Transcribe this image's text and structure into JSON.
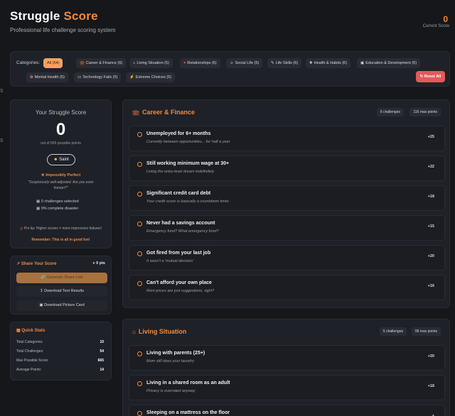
{
  "header": {
    "title_main": "Struggle",
    "title_accent": "Score",
    "subtitle": "Professional life challenge scoring system",
    "current_score": "0",
    "current_score_label": "Current Score"
  },
  "edge_marks": [
    "s",
    "s"
  ],
  "categories": {
    "label": "Categories:",
    "chips": [
      {
        "label": "All (54)",
        "icon": "",
        "active": true
      },
      {
        "label": "Career & Finance (6)",
        "icon": "briefcase-icon"
      },
      {
        "label": "Living Situation (5)",
        "icon": "house-icon"
      },
      {
        "label": "Relationships (6)",
        "icon": "heart-icon"
      },
      {
        "label": "Social Life (5)",
        "icon": "people-icon"
      },
      {
        "label": "Life Skills (6)",
        "icon": "wrench-icon"
      },
      {
        "label": "Health & Habits (6)",
        "icon": "health-icon"
      },
      {
        "label": "Education & Development (5)",
        "icon": "book-icon"
      },
      {
        "label": "Mental Health (5)",
        "icon": "brain-icon"
      },
      {
        "label": "Technology Fails (5)",
        "icon": "laptop-icon"
      },
      {
        "label": "Extreme Choices (5)",
        "icon": "lightning-icon"
      }
    ],
    "reset_label": "Reset All"
  },
  "your_score": {
    "title": "Your Struggle Score",
    "value": "0",
    "sub": "out of 665 possible points",
    "badge": "Saint",
    "rank": "Impossibly Perfect",
    "quote": "\"Suspiciously well-adjusted. Are you even human?\"",
    "selected": "0 challenges selected",
    "disaster": "0% complete disaster",
    "tip": "Pro tip: Higher scores = more impressive failures!",
    "remember": "Remember: This is all in good fun!"
  },
  "share": {
    "title": "Share Your Score",
    "pts": "0 pts",
    "generate": "Generate Share Link",
    "download_text": "Download Text Results",
    "download_picture": "Download Picture Card"
  },
  "quick_stats": {
    "title": "Quick Stats",
    "rows": [
      {
        "label": "Total Categories:",
        "value": "10"
      },
      {
        "label": "Total Challenges:",
        "value": "54"
      },
      {
        "label": "Max Possible Score:",
        "value": "665"
      },
      {
        "label": "Average Points:",
        "value": "14"
      }
    ]
  },
  "sections": [
    {
      "title": "Career & Finance",
      "challenges": "6 challenges",
      "max_points": "116 max points",
      "items": [
        {
          "name": "Unemployed for 6+ months",
          "desc": "Currently between opportunities... for half a year",
          "pts": "+25"
        },
        {
          "name": "Still working minimum wage at 30+",
          "desc": "Living the entry-level dream indefinitely",
          "pts": "+22"
        },
        {
          "name": "Significant credit card debt",
          "desc": "Your credit score is basically a countdown timer",
          "pts": "+18"
        },
        {
          "name": "Never had a savings account",
          "desc": "Emergency fund? What emergency fund?",
          "pts": "+15"
        },
        {
          "name": "Got fired from your last job",
          "desc": "It wasn't a 'mutual decision'",
          "pts": "+20"
        },
        {
          "name": "Can't afford your own place",
          "desc": "Rent prices are just suggestions, right?",
          "pts": "+16"
        }
      ]
    },
    {
      "title": "Living Situation",
      "challenges": "5 challenges",
      "max_points": "99 max points",
      "items": [
        {
          "name": "Living with parents (25+)",
          "desc": "Mom still does your laundry",
          "pts": "+20"
        },
        {
          "name": "Living in a shared room as an adult",
          "desc": "Privacy is overrated anyway",
          "pts": "+18"
        },
        {
          "name": "Sleeping on a mattress on the floor",
          "desc": "",
          "pts": "+"
        }
      ]
    }
  ]
}
